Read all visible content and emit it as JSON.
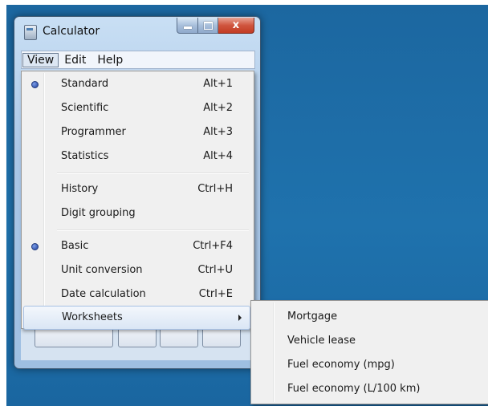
{
  "window": {
    "title": "Calculator",
    "controls": {
      "minimize": "minimize-icon",
      "maximize": "maximize-icon",
      "close": "close-icon",
      "close_glyph": "x"
    }
  },
  "menubar": [
    {
      "label": "View",
      "active": true
    },
    {
      "label": "Edit",
      "active": false
    },
    {
      "label": "Help",
      "active": false
    }
  ],
  "view_menu": {
    "groups": [
      [
        {
          "label": "Standard",
          "shortcut": "Alt+1",
          "selected": true
        },
        {
          "label": "Scientific",
          "shortcut": "Alt+2",
          "selected": false
        },
        {
          "label": "Programmer",
          "shortcut": "Alt+3",
          "selected": false
        },
        {
          "label": "Statistics",
          "shortcut": "Alt+4",
          "selected": false
        }
      ],
      [
        {
          "label": "History",
          "shortcut": "Ctrl+H",
          "selected": false
        },
        {
          "label": "Digit grouping",
          "shortcut": "",
          "selected": false
        }
      ],
      [
        {
          "label": "Basic",
          "shortcut": "Ctrl+F4",
          "selected": true
        },
        {
          "label": "Unit conversion",
          "shortcut": "Ctrl+U",
          "selected": false
        },
        {
          "label": "Date calculation",
          "shortcut": "Ctrl+E",
          "selected": false
        },
        {
          "label": "Worksheets",
          "shortcut": "",
          "selected": false,
          "submenu": true,
          "highlighted": true
        }
      ]
    ]
  },
  "worksheets_submenu": [
    {
      "label": "Mortgage"
    },
    {
      "label": "Vehicle lease"
    },
    {
      "label": "Fuel economy (mpg)"
    },
    {
      "label": "Fuel economy (L/100 km)"
    }
  ],
  "colors": {
    "desktop": "#1f6fa8",
    "menu_bg": "#f0f0f0",
    "highlight_border": "#a8c1e3",
    "close_button": "#c23b23"
  }
}
